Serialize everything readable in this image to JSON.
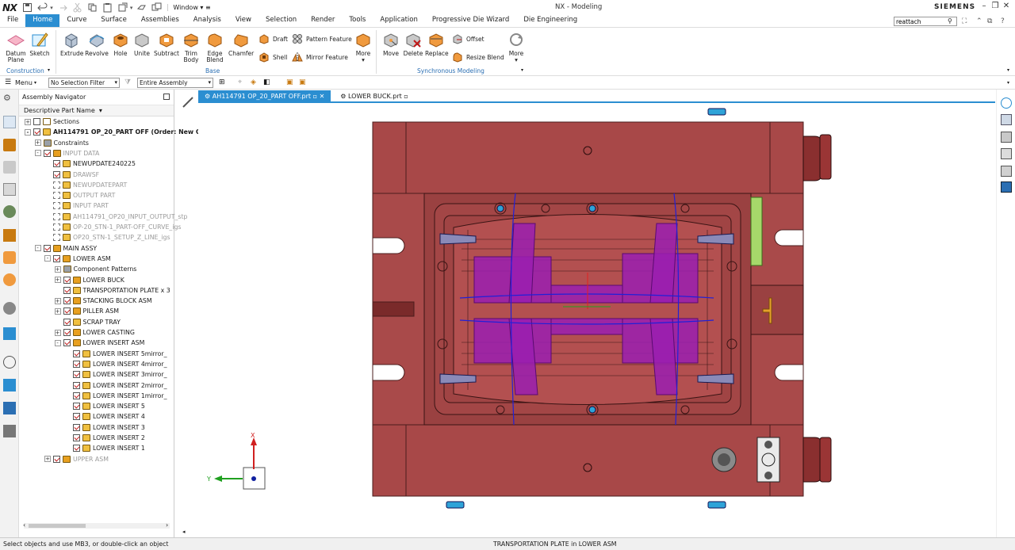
{
  "app": {
    "logo": "NX",
    "title": "NX - Modeling",
    "brand": "SIEMENS",
    "window_menu": "Window"
  },
  "tabs": [
    "File",
    "Home",
    "Curve",
    "Surface",
    "Assemblies",
    "Analysis",
    "View",
    "Selection",
    "Render",
    "Tools",
    "Application",
    "Progressive Die Wizard",
    "Die Engineering"
  ],
  "search": {
    "value": "reattach"
  },
  "ribbon": {
    "construction": {
      "datum": "Datum",
      "datum2": "Plane",
      "sketch": "Sketch",
      "label": "Construction"
    },
    "base": {
      "extrude": "Extrude",
      "revolve": "Revolve",
      "hole": "Hole",
      "unite": "Unite",
      "subtract": "Subtract",
      "trim": "Trim",
      "trim2": "Body",
      "edge": "Edge",
      "edge2": "Blend",
      "chamfer": "Chamfer",
      "draft": "Draft",
      "shell": "Shell",
      "pattern": "Pattern Feature",
      "mirror": "Mirror Feature",
      "more": "More",
      "label": "Base"
    },
    "sync": {
      "move": "Move",
      "delete": "Delete",
      "replace": "Replace",
      "offset": "Offset",
      "resize": "Resize Blend",
      "more": "More",
      "label": "Synchronous Modeling"
    }
  },
  "toolbar": {
    "menu": "Menu",
    "filter": "No Selection Filter",
    "scope": "Entire Assembly"
  },
  "navigator": {
    "title": "Assembly Navigator",
    "column": "Descriptive Part Name",
    "rows": [
      "Sections",
      "AH114791 OP_20_PART OFF (Order: New C",
      "Constraints",
      "INPUT DATA",
      "NEWUPDATE240225",
      "DRAWSF",
      "NEWUPDATEPART",
      "OUTPUT PART",
      "INPUT PART",
      "AH114791_OP20_INPUT_OUTPUT_stp",
      "OP-20_STN-1_PART-OFF_CURVE_igs",
      "OP20_STN-1_SETUP_Z_LINE_igs",
      "MAIN ASSY",
      "LOWER ASM",
      "Component Patterns",
      "LOWER BUCK",
      "TRANSPORTATION PLATE x 3",
      "STACKING BLOCK ASM",
      "PILLER ASM",
      "SCRAP TRAY",
      "LOWER CASTING",
      "LOWER INSERT ASM",
      "LOWER INSERT 5mirror_",
      "LOWER INSERT 4mirror_",
      "LOWER INSERT 3mirror_",
      "LOWER INSERT 2mirror_",
      "LOWER INSERT 1mirror_",
      "LOWER INSERT 5",
      "LOWER INSERT 4",
      "LOWER INSERT 3",
      "LOWER INSERT 2",
      "LOWER INSERT 1",
      "UPPER ASM"
    ]
  },
  "documents": [
    "AH114791 OP_20_PART OFF.prt",
    "LOWER BUCK.prt"
  ],
  "triad": {
    "x": "X",
    "y": "Y"
  },
  "status": {
    "left": "Select objects and use MB3, or double-click an object",
    "center": "TRANSPORTATION PLATE in LOWER ASM"
  },
  "colors": {
    "accent": "#2b8ed1",
    "die": "#a94a4a",
    "purple": "#9a1fb0"
  }
}
